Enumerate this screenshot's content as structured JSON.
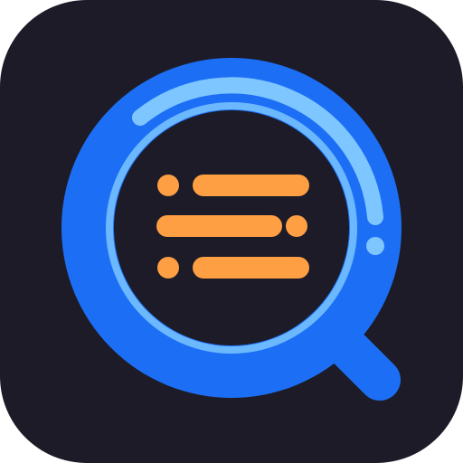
{
  "icon": {
    "semantic": "magnifier-with-list-icon",
    "colors": {
      "tile_background": "#1c1b27",
      "lens_ring": "#1c6ff5",
      "lens_inner_ring": "#6cb8ff",
      "lens_highlight": "#7ec6ff",
      "lens_center": "#1c1b27",
      "list_lines": "#ff9f43"
    }
  }
}
